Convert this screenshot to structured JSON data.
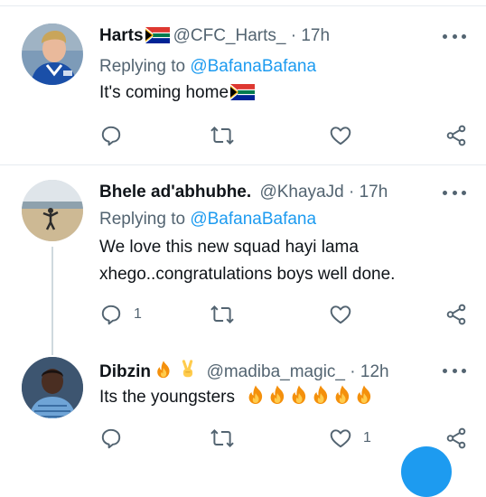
{
  "tweets": [
    {
      "name": "Harts",
      "handle": "@CFC_Harts_",
      "separator": "·",
      "time": "17h",
      "replying_label": "Replying to",
      "replying_to": "@BafanaBafana",
      "text": "It's coming home",
      "reply_count": "",
      "like_count": ""
    },
    {
      "name": "Bhele ad'abhubhe.",
      "handle": "@KhayaJd",
      "separator": "·",
      "time": "17h",
      "replying_label": "Replying to",
      "replying_to": "@BafanaBafana",
      "text_line1": "We love this new squad hayi lama",
      "text_line2": "xhego..congratulations boys well done.",
      "reply_count": "1",
      "like_count": ""
    },
    {
      "name": "Dibzin",
      "handle": "@madiba_magic_",
      "separator": "·",
      "time": "12h",
      "text": "Its the youngsters",
      "reply_count": "",
      "like_count": "1"
    }
  ],
  "icons": {
    "reply": "reply-icon",
    "retweet": "retweet-icon",
    "like": "heart-icon",
    "share": "share-icon",
    "more": "more-icon",
    "flag": "south-africa-flag-icon",
    "fire": "fire-emoji",
    "victory": "victory-hand-emoji"
  },
  "colors": {
    "accent": "#1d9bf0",
    "secondary_text": "#536471",
    "divider": "#e6ecf0",
    "thread_line": "#cfd9de"
  }
}
